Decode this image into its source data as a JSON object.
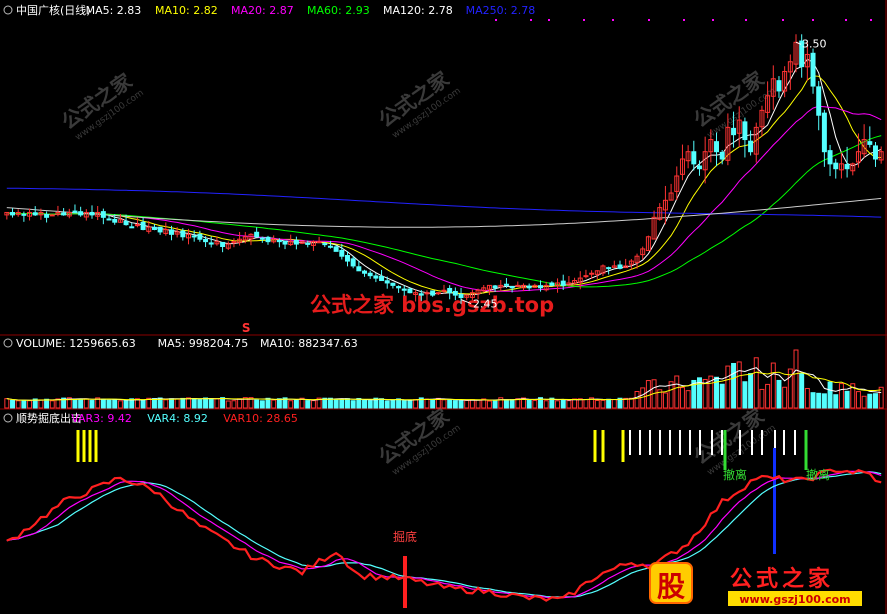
{
  "colors": {
    "background": "#000000",
    "frame": "#8b0000",
    "up": "#ff3333",
    "down": "#54ffff",
    "ma5": "#ffffff",
    "ma10": "#ffff00",
    "ma20": "#ff00ff",
    "ma60": "#00ff00",
    "ma120": "#ffffff",
    "ma250": "#2222ff",
    "var3": "#ff00ff",
    "var4": "#54ffff",
    "var10": "#ff2020",
    "signal_yellow": "#ffff00",
    "signal_white": "#ffffff",
    "signal_green": "#33dd33",
    "signal_blue": "#1030ff",
    "watermark_red": "#ff2020",
    "watermark_gray": "#6a6a6a"
  },
  "price_panel": {
    "title": "中国广核(日线)",
    "indicators": [
      {
        "label": "MA5: 2.83",
        "color": "#ffffff"
      },
      {
        "label": "MA10: 2.82",
        "color": "#ffff00"
      },
      {
        "label": "MA20: 2.87",
        "color": "#ff00ff"
      },
      {
        "label": "MA60: 2.93",
        "color": "#00ff00"
      },
      {
        "label": "MA120: 2.78",
        "color": "#ffffff"
      },
      {
        "label": "MA250: 2.78",
        "color": "#2222ff"
      }
    ],
    "high_marker": "3.50",
    "low_marker": "2.45",
    "signal_mark": "S"
  },
  "volume_panel": {
    "title": "VOLUME: 1259665.63",
    "indicators": [
      {
        "label": "MA5: 998204.75",
        "color": "#ffffff"
      },
      {
        "label": "MA10: 882347.63",
        "color": "#ffffff"
      }
    ]
  },
  "indicator_panel": {
    "title": "顺势掘底出击",
    "indicators": [
      {
        "label": "VAR3: 9.42",
        "color": "#ff00ff"
      },
      {
        "label": "VAR4: 8.92",
        "color": "#54ffff"
      },
      {
        "label": "VAR10: 28.65",
        "color": "#ff2020"
      }
    ],
    "annotations": {
      "dig": "掘底",
      "exit1": "撤离",
      "exit2": "撤离"
    }
  },
  "watermarks": {
    "diag": "公式之家",
    "diag_url": "www.gszj100.com",
    "center": "公式之家 bbs.gszb.top",
    "logo_glyph": "股",
    "logo_text": "公式之家",
    "logo_url": "www.gszj100.com"
  },
  "chart_data": [
    {
      "type": "candlestick",
      "name": "price",
      "ylim": [
        2.3,
        3.6
      ],
      "high": 3.5,
      "low": 2.45,
      "ma_last": {
        "MA5": 2.83,
        "MA10": 2.82,
        "MA20": 2.87,
        "MA60": 2.93,
        "MA120": 2.78,
        "MA250": 2.78
      },
      "close_path": [
        2.8,
        2.79,
        2.8,
        2.79,
        2.8,
        2.79,
        2.8,
        2.78,
        2.79,
        2.8,
        2.79,
        2.8,
        2.8,
        2.79,
        2.8,
        2.79,
        2.8,
        2.78,
        2.77,
        2.76,
        2.77,
        2.75,
        2.74,
        2.75,
        2.73,
        2.74,
        2.73,
        2.72,
        2.73,
        2.71,
        2.72,
        2.7,
        2.71,
        2.7,
        2.69,
        2.68,
        2.67,
        2.68,
        2.66,
        2.67,
        2.68,
        2.69,
        2.7,
        2.71,
        2.7,
        2.69,
        2.68,
        2.69,
        2.68,
        2.67,
        2.68,
        2.67,
        2.68,
        2.67,
        2.68,
        2.68,
        2.67,
        2.66,
        2.64,
        2.62,
        2.6,
        2.58,
        2.56,
        2.55,
        2.54,
        2.53,
        2.52,
        2.51,
        2.5,
        2.49,
        2.48,
        2.47,
        2.47,
        2.46,
        2.47,
        2.46,
        2.47,
        2.48,
        2.47,
        2.46,
        2.45,
        2.46,
        2.47,
        2.48,
        2.49,
        2.5,
        2.49,
        2.5,
        2.5,
        2.49,
        2.5,
        2.5,
        2.49,
        2.5,
        2.49,
        2.5,
        2.5,
        2.51,
        2.5,
        2.51,
        2.52,
        2.53,
        2.54,
        2.55,
        2.56,
        2.58,
        2.57,
        2.58,
        2.57,
        2.58,
        2.6,
        2.62,
        2.65,
        2.7,
        2.78,
        2.82,
        2.85,
        2.88,
        2.95,
        3.02,
        3.05,
        3.0,
        2.98,
        3.05,
        3.1,
        3.05,
        3.02,
        3.15,
        3.12,
        3.18,
        3.1,
        3.05,
        3.15,
        3.22,
        3.28,
        3.35,
        3.3,
        3.38,
        3.42,
        3.5,
        3.4,
        3.45,
        3.32,
        3.2,
        3.05,
        3.0,
        2.98,
        3.0,
        2.98,
        3.0,
        3.05,
        3.1,
        3.08,
        3.02,
        3.05
      ]
    },
    {
      "type": "bar",
      "name": "volume",
      "current": 1259665.63,
      "ma5": 998204.75,
      "ma10": 882347.63
    },
    {
      "type": "line",
      "name": "顺势掘底出击",
      "series": [
        {
          "name": "VAR3",
          "last": 9.42
        },
        {
          "name": "VAR4",
          "last": 8.92
        },
        {
          "name": "VAR10",
          "last": 28.65
        }
      ]
    }
  ]
}
